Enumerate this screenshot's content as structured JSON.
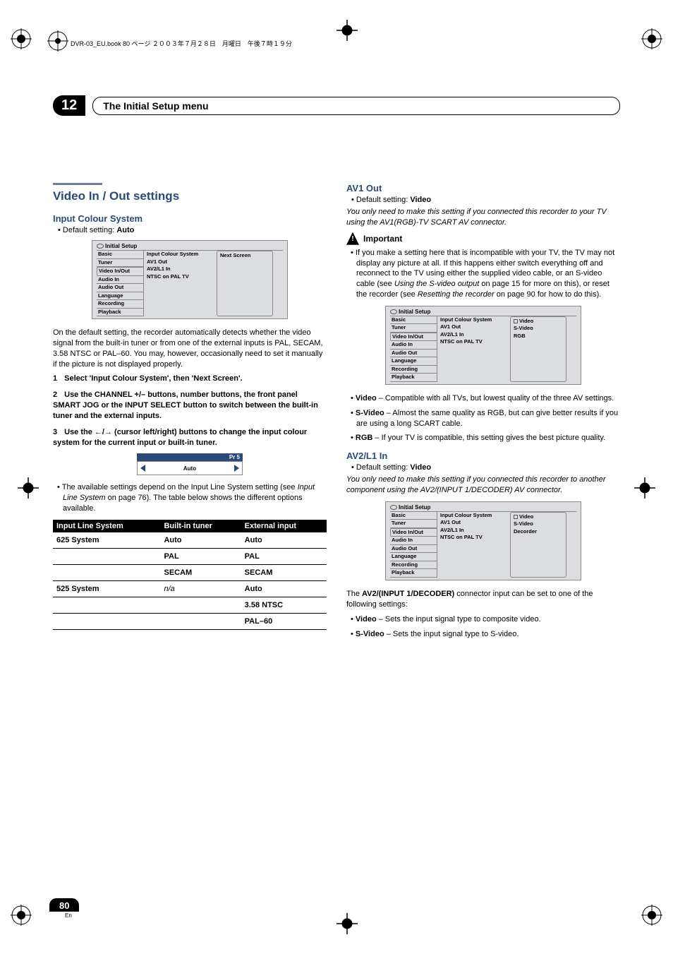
{
  "header_line": "DVR-03_EU.book 80 ページ ２００３年７月２８日　月曜日　午後７時１９分",
  "chapter": {
    "number": "12",
    "title": "The Initial Setup menu"
  },
  "left": {
    "section": "Video In / Out settings",
    "sub1": "Input Colour System",
    "default1_pre": "Default setting: ",
    "default1_val": "Auto",
    "menu1": {
      "title": "Initial Setup",
      "sidebar": [
        "Basic",
        "Tuner",
        "Video In/Out",
        "Audio In",
        "Audio Out",
        "Language",
        "Recording",
        "Playback"
      ],
      "settings": [
        "Input Colour System",
        "AV1 Out",
        "AV2/L1 In",
        "NTSC on PAL TV"
      ],
      "value": "Next Screen"
    },
    "para1": "On the default setting, the recorder automatically detects whether the video signal from the built-in tuner or from one of the external inputs is PAL, SECAM, 3.58 NTSC or PAL–60. You may, however, occasionally need to set it manually if the picture is not displayed properly.",
    "step1": "Select 'Input Colour System', then 'Next Screen'.",
    "step2": "Use the CHANNEL +/– buttons, number buttons, the front panel SMART JOG or the INPUT SELECT button to switch between the built-in tuner and the external inputs.",
    "step3_pre": "Use the ",
    "step3_mid": " (cursor left/right) buttons to change the input colour system for the current input or built-in tuner.",
    "tuner": {
      "head": "Pr 5",
      "value": "Auto"
    },
    "bullet1": "The available settings depend on the Input Line System setting (see Input Line System on page 76). The table below shows the different options available.",
    "table": {
      "headers": [
        "Input Line System",
        "Built-in tuner",
        "External input"
      ],
      "rows": [
        [
          "625 System",
          "Auto",
          "Auto"
        ],
        [
          "",
          "PAL",
          "PAL"
        ],
        [
          "",
          "SECAM",
          "SECAM"
        ],
        [
          "525 System",
          "n/a",
          "Auto"
        ],
        [
          "",
          "",
          "3.58 NTSC"
        ],
        [
          "",
          "",
          "PAL–60"
        ]
      ]
    }
  },
  "right": {
    "sub_av1": "AV1 Out",
    "av1_default_pre": "Default setting: ",
    "av1_default_val": "Video",
    "av1_note": "You only need to make this setting if you connected this recorder to your TV using the AV1(RGB)-TV SCART AV connector.",
    "important_label": "Important",
    "important_text_pre": "If you make a setting here that is incompatible with your TV, the TV may not display any picture at all. If this happens either switch everything off and reconnect to the TV using either the supplied video cable, or an S-video cable (see ",
    "important_text_it1": "Using the S-video output",
    "important_text_mid": " on page 15 for more on this), or reset the recorder (see ",
    "important_text_it2": "Resetting the recorder",
    "important_text_post": " on page 90 for how to do this).",
    "menu2": {
      "title": "Initial Setup",
      "sidebar": [
        "Basic",
        "Tuner",
        "Video In/Out",
        "Audio In",
        "Audio Out",
        "Language",
        "Recording",
        "Playback"
      ],
      "settings": [
        "Input Colour System",
        "AV1 Out",
        "AV2/L1 In",
        "NTSC on PAL TV"
      ],
      "values": [
        "Video",
        "S-Video",
        "RGB"
      ]
    },
    "av1_bullets": [
      {
        "b": "Video",
        "t": " – Compatible with all TVs, but lowest quality of the three AV settings."
      },
      {
        "b": "S-Video",
        "t": " – Almost the same quality as RGB, but can give better results if you are using a long SCART cable."
      },
      {
        "b": "RGB",
        "t": " – If your TV is compatible, this setting gives the best picture quality."
      }
    ],
    "sub_av2": "AV2/L1 In",
    "av2_default_pre": "Default setting: ",
    "av2_default_val": "Video",
    "av2_note": "You only need to make this setting if you connected this recorder to another component using the AV2/(INPUT 1/DECODER) AV connector.",
    "menu3": {
      "title": "Initial Setup",
      "sidebar": [
        "Basic",
        "Tuner",
        "Video In/Out",
        "Audio In",
        "Audio Out",
        "Language",
        "Recording",
        "Playback"
      ],
      "settings": [
        "Input Colour System",
        "AV1 Out",
        "AV2/L1 In",
        "NTSC on PAL TV"
      ],
      "values": [
        "Video",
        "S-Video",
        "Decorder"
      ]
    },
    "av2_line_pre": "The ",
    "av2_line_b": "AV2/(INPUT 1/DECODER)",
    "av2_line_post": " connector input can be set to one of the following settings:",
    "av2_bullets": [
      {
        "b": "Video",
        "t": " – Sets the input signal type to composite video."
      },
      {
        "b": "S-Video",
        "t": " – Sets the input signal type to S-video."
      }
    ]
  },
  "page_number": "80",
  "page_lang": "En"
}
